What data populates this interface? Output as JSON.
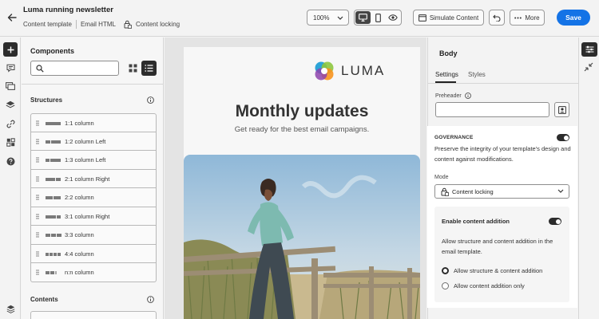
{
  "header": {
    "title": "Luma running newsletter",
    "meta_type": "Content template",
    "meta_format": "Email HTML",
    "meta_locking": "Content locking",
    "zoom": "100%",
    "simulate_label": "Simulate Content",
    "more_label": "More",
    "save_label": "Save"
  },
  "components": {
    "title": "Components",
    "structures_label": "Structures",
    "structures": [
      {
        "label": "1:1 column"
      },
      {
        "label": "1:2 column Left"
      },
      {
        "label": "1:3 column Left"
      },
      {
        "label": "2:1 column Right"
      },
      {
        "label": "2:2 column"
      },
      {
        "label": "3:1 column Right"
      },
      {
        "label": "3:3 column"
      },
      {
        "label": "4:4 column"
      },
      {
        "label": "n:n column"
      }
    ],
    "contents_label": "Contents"
  },
  "email": {
    "brand": "LUMA",
    "headline": "Monthly updates",
    "subheadline": "Get ready for the best email campaigns."
  },
  "props": {
    "title": "Body",
    "tabs": [
      "Settings",
      "Styles"
    ],
    "active_tab": "Settings",
    "preheader_label": "Preheader",
    "preheader_value": "",
    "governance": {
      "title": "GOVERNANCE",
      "enabled": true,
      "description": "Preserve the integrity of your template's design and content against modifications.",
      "mode_label": "Mode",
      "mode_value": "Content locking",
      "content_addition": {
        "title": "Enable content addition",
        "enabled": true,
        "description": "Allow structure and content addition in the email template.",
        "options": [
          {
            "label": "Allow structure & content addition",
            "selected": true
          },
          {
            "label": "Allow content addition only",
            "selected": false
          }
        ]
      }
    }
  },
  "colors": {
    "accent": "#1473e6",
    "dark": "#2c2c2c"
  }
}
